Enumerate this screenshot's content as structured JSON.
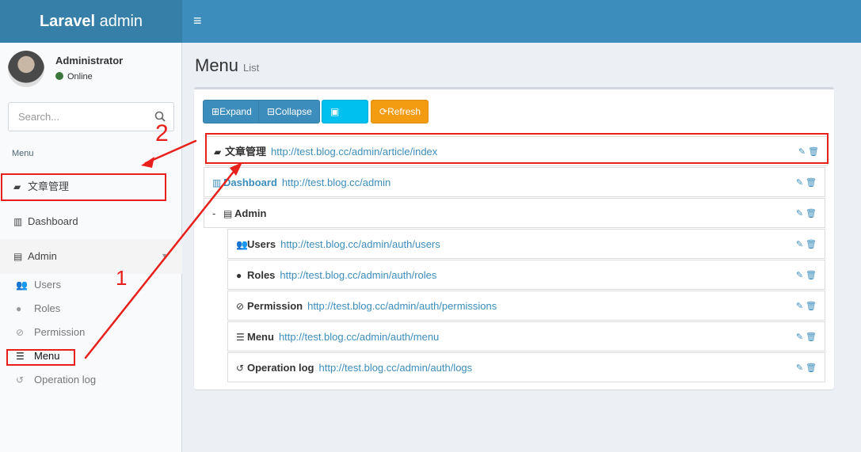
{
  "header": {
    "brand_bold": "Laravel",
    "brand_rest": " admin",
    "toggle_icon": "≡"
  },
  "user": {
    "name": "Administrator",
    "status": "Online"
  },
  "search": {
    "placeholder": "Search..."
  },
  "sidebar": {
    "header": "Menu",
    "items": [
      {
        "label": "文章管理",
        "icon": "book-icon"
      },
      {
        "label": "Dashboard",
        "icon": "bar-chart-icon"
      },
      {
        "label": "Admin",
        "icon": "tasks-icon"
      }
    ],
    "sub_items": [
      {
        "label": "Users",
        "icon": "users-icon"
      },
      {
        "label": "Roles",
        "icon": "user-icon"
      },
      {
        "label": "Permission",
        "icon": "ban-icon"
      },
      {
        "label": "Menu",
        "icon": "bars-icon"
      },
      {
        "label": "Operation log",
        "icon": "history-icon"
      }
    ]
  },
  "page": {
    "title": "Menu",
    "subtitle": "List"
  },
  "toolbar": {
    "expand": "Expand",
    "collapse": "Collapse",
    "save": "Save",
    "refresh": "Refresh"
  },
  "menu_tree": [
    {
      "title": "文章管理",
      "url": "http://test.blog.cc/admin/article/index"
    },
    {
      "title": "Dashboard",
      "url": "http://test.blog.cc/admin"
    },
    {
      "title": "Admin",
      "url": ""
    },
    {
      "title": "Users",
      "url": "http://test.blog.cc/admin/auth/users"
    },
    {
      "title": "Roles",
      "url": "http://test.blog.cc/admin/auth/roles"
    },
    {
      "title": "Permission",
      "url": "http://test.blog.cc/admin/auth/permissions"
    },
    {
      "title": "Menu",
      "url": "http://test.blog.cc/admin/auth/menu"
    },
    {
      "title": "Operation log",
      "url": "http://test.blog.cc/admin/auth/logs"
    }
  ],
  "annotations": {
    "mark_1": "1",
    "mark_2": "2"
  },
  "colors": {
    "header": "#3c8dbc",
    "logo_bg": "#367fa9",
    "save": "#00c0ef",
    "refresh": "#f39c12",
    "annotation": "#e8201b"
  }
}
